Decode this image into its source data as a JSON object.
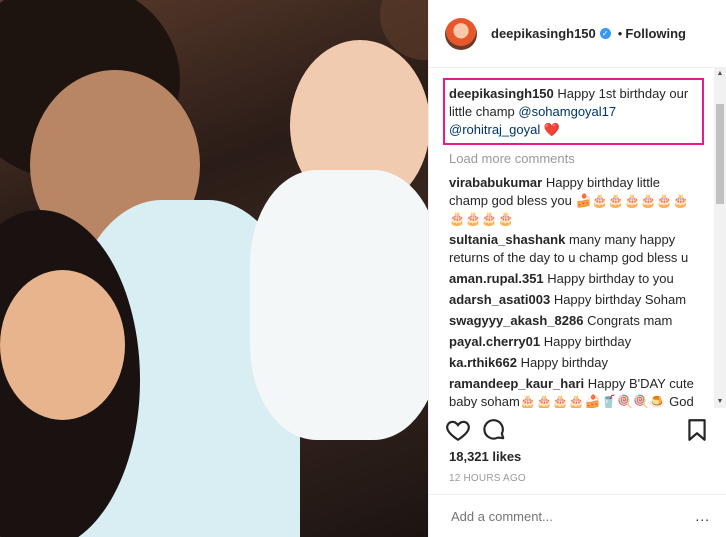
{
  "header": {
    "username": "deepikasingh150",
    "separator": "•",
    "follow_state": "Following"
  },
  "caption": {
    "username": "deepikasingh150",
    "text": "Happy 1st birthday our little champ",
    "mention1": "@sohamgoyal17",
    "mention2": "@rohitraj_goyal",
    "emoji": "❤️",
    "highlight_color": "#e6198f"
  },
  "load_more": "Load more comments",
  "comments": [
    {
      "user": "virababukumar",
      "text": "Happy birthday little champ god bless you 🍰🎂🎂🎂🎂🎂🎂🎂🎂🎂🎂"
    },
    {
      "user": "sultania_shashank",
      "text": "many many happy returns of the day to u champ god bless u"
    },
    {
      "user": "aman.rupal.351",
      "text": "Happy birthday to you"
    },
    {
      "user": "adarsh_asati003",
      "text": "Happy birthday Soham"
    },
    {
      "user": "swagyyy_akash_8286",
      "text": "Congrats mam"
    },
    {
      "user": "payal.cherry01",
      "text": "Happy birthday"
    },
    {
      "user": "ka.rthik662",
      "text": "Happy birthday"
    },
    {
      "user": "ramandeep_kaur_hari",
      "text": "Happy B'DAY cute baby soham🎂🎂🎂🎂🍰🥤🍭🍭🍮 God Bless you 😇😇😊💝💝💖❤️❤️❤️ 💝😇😊"
    }
  ],
  "icons": {
    "like": "heart-icon",
    "comment": "comment-icon",
    "save": "bookmark-icon",
    "more": "more-icon"
  },
  "likes": "18,321 likes",
  "timestamp": "12 HOURS AGO",
  "add_comment": {
    "placeholder": "Add a comment..."
  },
  "more_label": "...",
  "colors": {
    "verified": "#3897f0",
    "link": "#003569",
    "muted": "#999999"
  }
}
